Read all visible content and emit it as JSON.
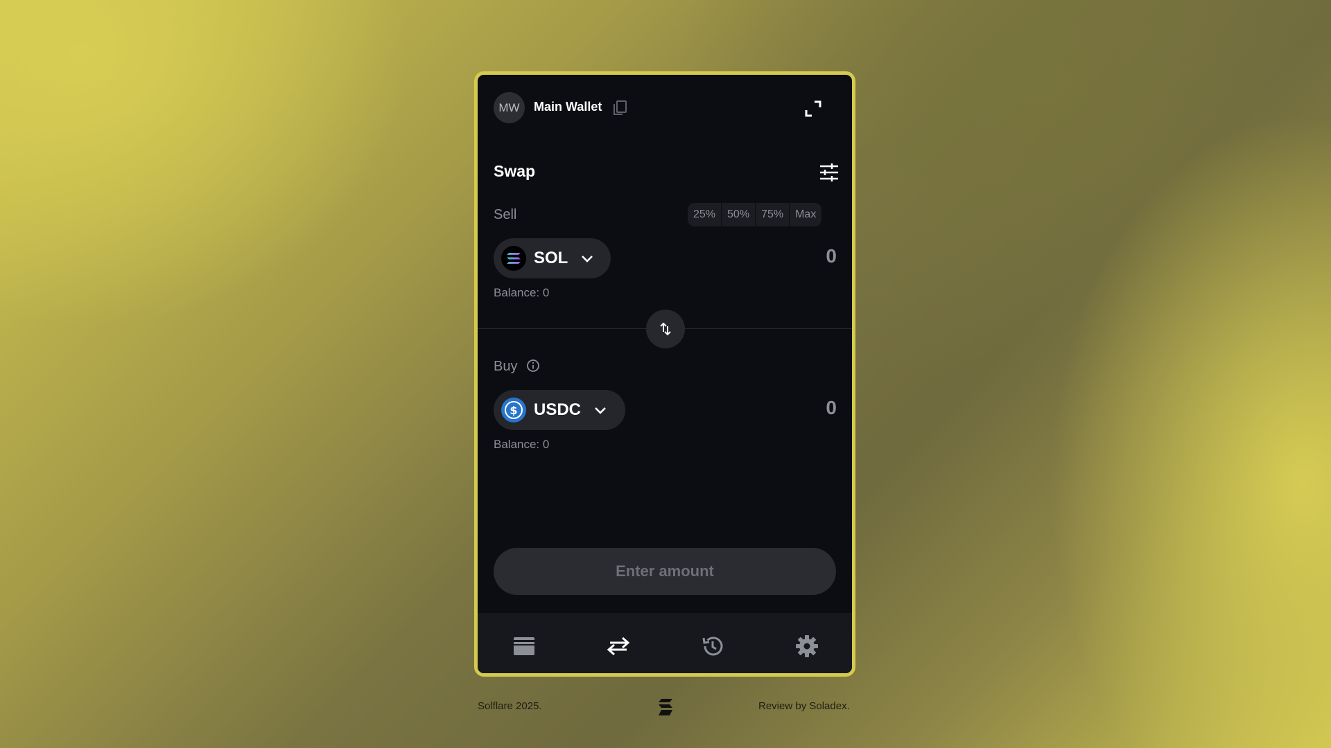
{
  "header": {
    "avatar_initials": "MW",
    "wallet_name": "Main Wallet"
  },
  "swap": {
    "title": "Swap",
    "sell": {
      "label": "Sell",
      "percent_options": [
        "25%",
        "50%",
        "75%",
        "Max"
      ],
      "token": "SOL",
      "amount": "0",
      "balance": "Balance: 0"
    },
    "buy": {
      "label": "Buy",
      "token": "USDC",
      "amount": "0",
      "balance": "Balance: 0"
    },
    "cta_label": "Enter amount"
  },
  "nav": {
    "items": [
      {
        "icon": "wallet-icon",
        "active": false
      },
      {
        "icon": "swap-arrows-icon",
        "active": true
      },
      {
        "icon": "history-icon",
        "active": false
      },
      {
        "icon": "gear-icon",
        "active": false
      }
    ]
  },
  "footer": {
    "left": "Solflare 2025.",
    "right": "Review by Soladex."
  },
  "colors": {
    "panel_bg": "#0b0d12",
    "frame_border": "#d4cb4e",
    "usdc_blue": "#2775ca",
    "muted_text": "#8c8f96"
  }
}
